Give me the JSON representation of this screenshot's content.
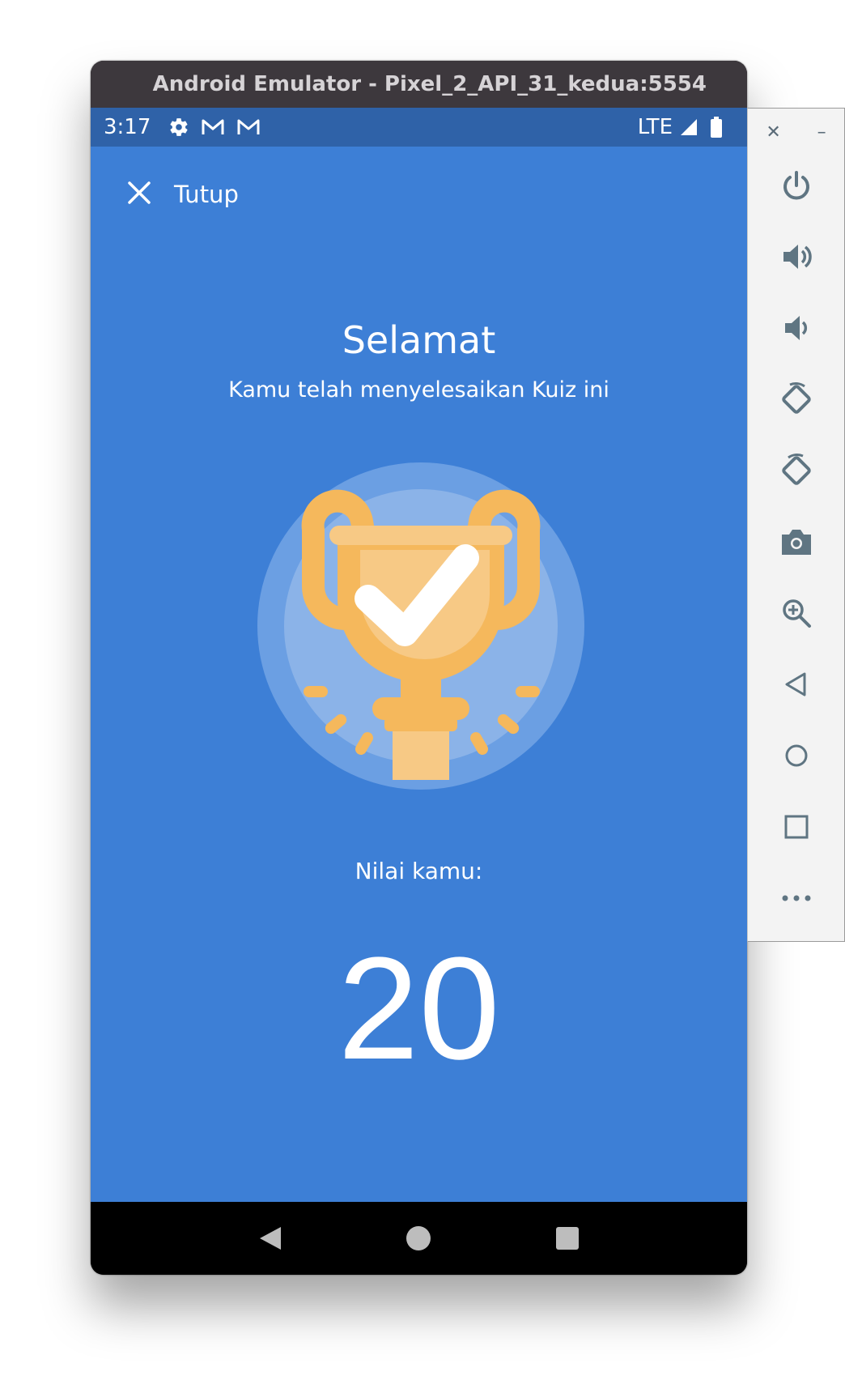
{
  "window": {
    "title": "Android Emulator - Pixel_2_API_31_kedua:5554"
  },
  "status_bar": {
    "time": "3:17",
    "network": "LTE",
    "icons": [
      "settings-icon",
      "gmail-icon",
      "gmail-icon",
      "signal-icon",
      "battery-icon"
    ]
  },
  "app": {
    "close_label": "Tutup",
    "heading": "Selamat",
    "subheading": "Kamu telah menyelesaikan Kuiz ini",
    "score_label": "Nilai kamu:",
    "score": "20",
    "illustration": "trophy-check-icon"
  },
  "colors": {
    "app_background": "#3d7fd6",
    "status_bar": "#2f62a8",
    "title_bar": "#3d383d",
    "trophy": "#f5b85c",
    "trophy_light": "#f7c985"
  },
  "nav_bar": {
    "buttons": [
      "back-icon",
      "home-icon",
      "recents-icon"
    ]
  },
  "side_toolbar": {
    "window_controls": [
      "close-icon",
      "minimize-icon"
    ],
    "tools": [
      "power-icon",
      "volume-up-icon",
      "volume-down-icon",
      "rotate-left-icon",
      "rotate-right-icon",
      "camera-icon",
      "zoom-icon",
      "back-icon",
      "home-icon",
      "overview-icon",
      "more-icon"
    ]
  }
}
